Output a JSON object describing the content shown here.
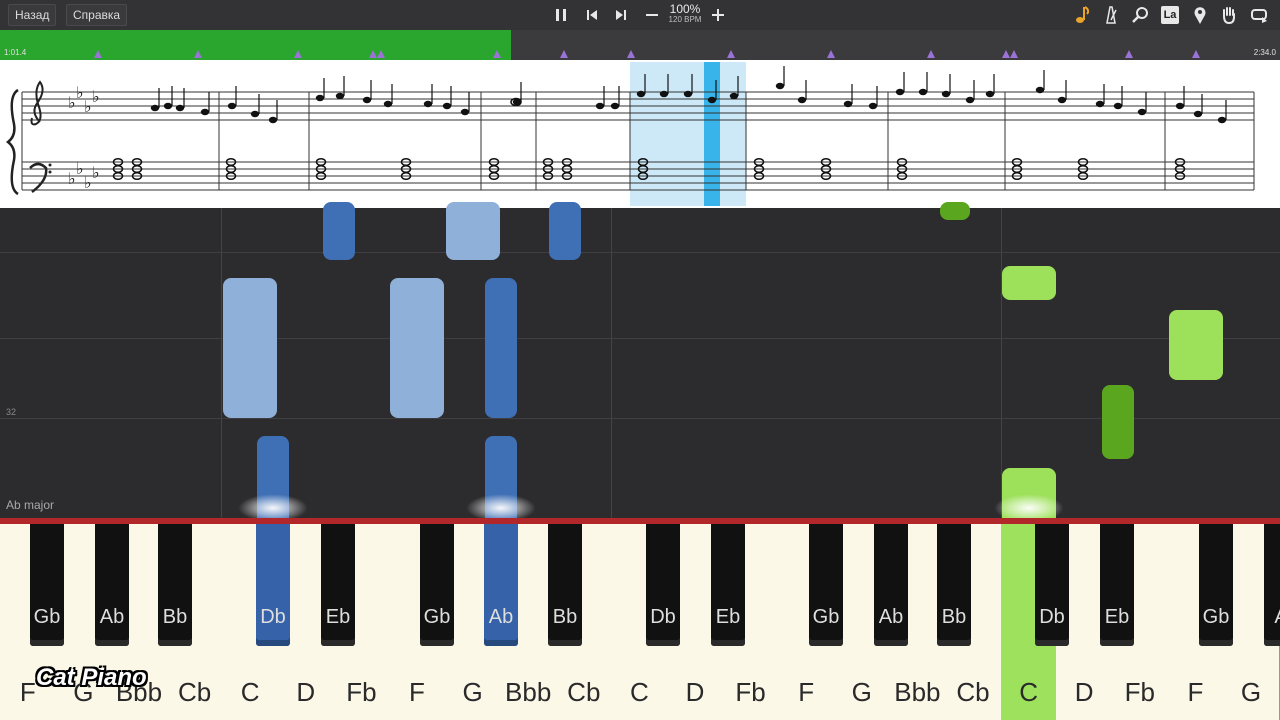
{
  "toolbar": {
    "back_label": "Назад",
    "help_label": "Справка",
    "zoom_label": "100%",
    "bpm_label": "120 BPM",
    "icons": [
      "pause-icon",
      "skip-back-icon",
      "skip-forward-icon",
      "minus-icon",
      "plus-icon",
      "note-icon",
      "metronome-icon",
      "search-icon",
      "key-label-icon",
      "pin-icon",
      "hand-icon",
      "loop-icon"
    ],
    "key_icon_text": "La"
  },
  "timeline": {
    "elapsed": "1:01.4",
    "total": "2:34.0",
    "progress": 0.4,
    "played_color": "#2aa52d",
    "marker_color": "#9a72d8"
  },
  "roll": {
    "key_signature": "Ab major",
    "measure_number": "32"
  },
  "keyboard": {
    "white_keys": [
      "F",
      "G",
      "Bbb",
      "Cb",
      "C",
      "D",
      "Fb",
      "F",
      "G",
      "Bbb",
      "Cb",
      "C",
      "D",
      "Fb",
      "F",
      "G",
      "Bbb",
      "Cb",
      "C",
      "D",
      "Fb",
      "F",
      "G"
    ],
    "black_keys": [
      "Gb",
      "Ab",
      "Bb",
      "Db",
      "Eb",
      "Gb",
      "Ab",
      "Bb",
      "Db",
      "Eb",
      "Gb",
      "Ab",
      "Bb",
      "Db",
      "Eb",
      "Gb",
      "A"
    ],
    "active_left_color": "#3562a8",
    "active_right_color": "#9ee15c"
  },
  "watermark": "Cat Piano"
}
